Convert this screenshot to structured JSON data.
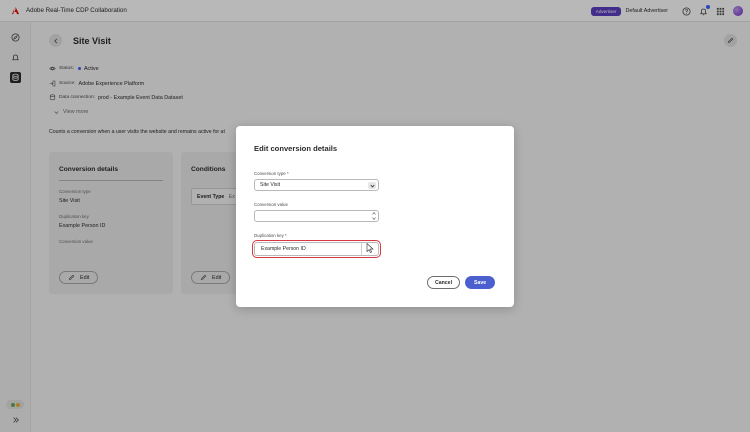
{
  "app": {
    "title": "Adobe Real-Time CDP Collaboration",
    "logo_icon": "adobe-logo",
    "role_badge": "Advertiser",
    "advertiser_name": "Default Advertiser",
    "accent_color": "#5c3ec2",
    "notification_indicator": true
  },
  "rail": {
    "items": [
      {
        "icon": "compass-icon",
        "active": false
      },
      {
        "icon": "bell-icon",
        "active": false
      },
      {
        "icon": "database-icon",
        "active": true
      }
    ]
  },
  "page": {
    "title": "Site Visit",
    "status_label": "Status:",
    "status_value": "Active",
    "source_label": "Source:",
    "source_value": "Adobe Experience Platform",
    "connection_label": "Data connection:",
    "connection_value": "prod - Example Event Data Dataset",
    "view_more": "View more",
    "description": "Counts a conversion when a user visits the website and remains active for at"
  },
  "conversion_card": {
    "title": "Conversion details",
    "type_label": "Conversion type",
    "type_value": "Site Visit",
    "dup_label": "Duplication key",
    "dup_value": "Example Person ID",
    "value_label": "Conversion value",
    "edit_label": "Edit"
  },
  "conditions_card": {
    "title": "Conditions",
    "event_type": "Event Type",
    "event_type_value_fragment": "Ex",
    "edit_label": "Edit"
  },
  "dialog": {
    "title": "Edit conversion details",
    "conversion_type_label": "Conversion type",
    "conversion_type_required": "*",
    "conversion_type_value": "Site Visit",
    "conversion_value_label": "Conversion value",
    "conversion_value": "",
    "duplication_key_label": "Duplication key",
    "duplication_key_required": "*",
    "duplication_key_value": "Example Person ID",
    "cancel_label": "Cancel",
    "save_label": "Save",
    "invalid_color": "#d7373f",
    "save_color": "#4b5fcf"
  }
}
